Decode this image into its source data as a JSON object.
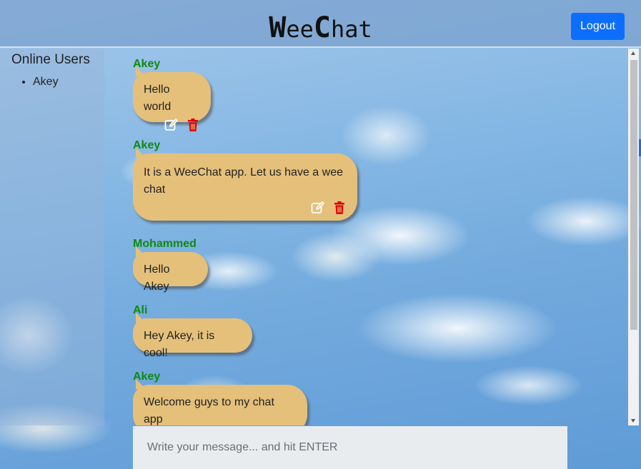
{
  "app": {
    "brand_w": "W",
    "brand_ee": "ee",
    "brand_c": "C",
    "brand_hat": "hat",
    "logout_label": "Logout"
  },
  "sidebar": {
    "title": "Online Users",
    "users": [
      "Akey"
    ]
  },
  "messages": [
    {
      "sender": "Akey",
      "text": "Hello world",
      "own": true
    },
    {
      "sender": "Akey",
      "text": "It is a WeeChat app. Let us have a wee chat",
      "own": true
    },
    {
      "sender": "Mohammed",
      "text": "Hello Akey",
      "own": false
    },
    {
      "sender": "Ali",
      "text": "Hey Akey, it is cool!",
      "own": false
    },
    {
      "sender": "Akey",
      "text": "Welcome guys to my chat app",
      "own": true
    }
  ],
  "composer": {
    "placeholder": "Write your message... and hit ENTER",
    "value": ""
  },
  "colors": {
    "bubble": "#e5c07a",
    "sender": "#118a11",
    "button": "#0d6efd",
    "delete": "#e00000"
  },
  "icons": {
    "edit": "edit-icon",
    "delete": "trash-icon"
  }
}
